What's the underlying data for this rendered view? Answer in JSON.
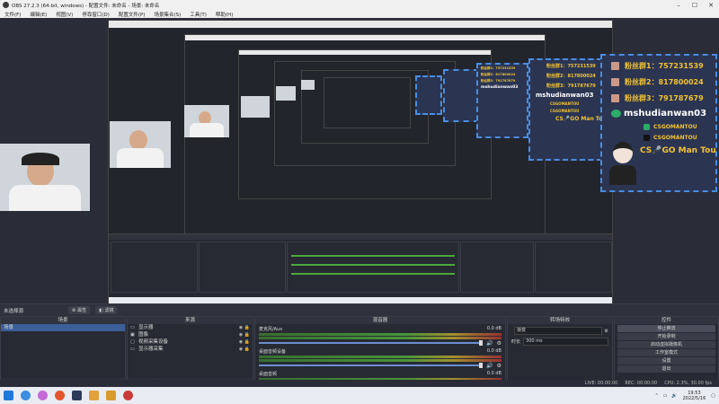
{
  "window": {
    "title": "OBS 27.2.3 (64-bit, windows) - 配置文件: 未命名 - 场景: 未命名"
  },
  "menu": [
    "文件(F)",
    "编辑(E)",
    "视图(V)",
    "停靠窗口(D)",
    "配置文件(P)",
    "场景集合(S)",
    "工具(T)",
    "帮助(H)"
  ],
  "overlay": {
    "fan1": "粉丝群1：757231539",
    "fan2": "粉丝群2：817800024",
    "fan3": "粉丝群3：791787679",
    "wechat": "mshudianwan03",
    "weibo": "CSGOMANTOU",
    "douyin": "CSGOMANTOU",
    "name": "CS🎤GO Man Tou"
  },
  "scene_bar": {
    "label": "未选择源",
    "btn_props": "属性",
    "btn_filters": "滤镜"
  },
  "scenes": {
    "header": "场景",
    "items": [
      "场景"
    ]
  },
  "sources": {
    "header": "来源",
    "items": [
      {
        "name": "显示器",
        "icon": "monitor-icon"
      },
      {
        "name": "图像",
        "icon": "image-icon"
      },
      {
        "name": "视频采集设备",
        "icon": "camera-icon"
      },
      {
        "name": "显示器采集",
        "icon": "monitor-icon"
      }
    ]
  },
  "mixer": {
    "header": "混音器",
    "tracks": [
      {
        "name": "麦克风/Aux",
        "db": "0.0 dB"
      },
      {
        "name": "桌面音频设备",
        "db": "0.0 dB"
      },
      {
        "name": "桌面音频",
        "db": "0.0 dB"
      }
    ]
  },
  "transitions": {
    "header": "转场特效",
    "type": "渐变",
    "duration_label": "时长",
    "duration": "300 ms"
  },
  "controls": {
    "header": "控件",
    "buttons": [
      "停止推流",
      "开始录制",
      "启动虚拟摄像机",
      "工作室模式",
      "设置",
      "退出"
    ]
  },
  "status": {
    "live": "LIVE: 00:00:00",
    "rec": "REC: 00:00:00",
    "cpu": "CPU: 2.3%, 30.00 fps"
  },
  "taskbar": {
    "time": "19:53",
    "date": "2022/5/16"
  },
  "colors": {
    "overlay_text": "#f2c232",
    "overlay_border": "#4a8de0",
    "selected": "#3c5f99"
  }
}
